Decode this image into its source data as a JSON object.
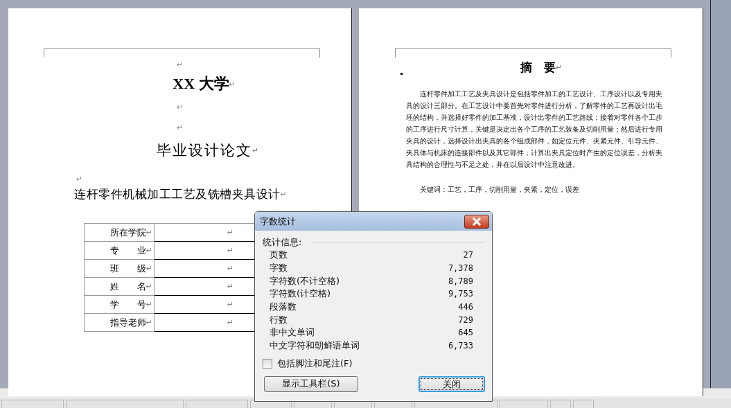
{
  "left_page": {
    "blocks": [
      {
        "kind": "mark_center",
        "text": "↵"
      },
      {
        "kind": "title",
        "text": "XX 大学",
        "mark": "↵"
      },
      {
        "kind": "mark_center",
        "text": "↵"
      },
      {
        "kind": "mark_center",
        "text": "↵"
      },
      {
        "kind": "subtitle",
        "text": "毕业设计论文",
        "mark": "↵"
      },
      {
        "kind": "mark_left",
        "text": "↵"
      },
      {
        "kind": "heading",
        "text": "连杆零件机械加工工艺及铣槽夹具设计",
        "mark": "↵"
      }
    ],
    "form_rows": [
      {
        "label": "所在学院",
        "label_mark": "↵",
        "value_mark": "↵"
      },
      {
        "label": "专　　业",
        "label_mark": "↵",
        "value_mark": "↵"
      },
      {
        "label": "班　　级",
        "label_mark": "↵",
        "value_mark": "↵"
      },
      {
        "label": "姓　　名",
        "label_mark": "↵",
        "value_mark": "↵"
      },
      {
        "label": "学　　号",
        "label_mark": "↵",
        "value_mark": "↵"
      },
      {
        "label": "指导老师",
        "label_mark": "↵",
        "value_mark": "↵"
      }
    ]
  },
  "right_page": {
    "title": "摘　要",
    "title_mark": "↵",
    "abstract": "连杆零件加工工艺及夹具设计是包括零件加工的工艺设计、工序设计以及专用夹具的设计三部分。在工艺设计中要首先对零件进行分析，了解零件的工艺再设计出毛坯的结构，并选择好零件的加工基准，设计出零件的工艺路线；接着对零件各个工步的工序进行尺寸计算，关键是决定出各个工序的工艺装备及切削用量；然后进行专用夹具的设计，选择设计出夹具的各个组成部件，如定位元件、夹紧元件、引导元件、夹具体与机床的连接部件以及其它部件；计算出夹具定位时产生的定位误差，分析夹具结构的合理性与不足之处，并在以后设计中注意改进。",
    "keywords": "关键词：工艺，工序，切削用量，夹紧，定位，误差"
  },
  "dialog": {
    "title": "字数统计",
    "section": "统计信息:",
    "stats": [
      {
        "label": "页数",
        "value": "27"
      },
      {
        "label": "字数",
        "value": "7,378"
      },
      {
        "label": "字符数(不计空格)",
        "value": "8,789"
      },
      {
        "label": "字符数(计空格)",
        "value": "9,753"
      },
      {
        "label": "段落数",
        "value": "446"
      },
      {
        "label": "行数",
        "value": "729"
      },
      {
        "label": "非中文单词",
        "value": "645"
      },
      {
        "label": "中文字符和朝鲜语单词",
        "value": "6,733"
      }
    ],
    "checkbox": {
      "label": "包括脚注和尾注(F)",
      "checked": false
    },
    "buttons": [
      {
        "label": "显示工具栏(S)",
        "focused": false
      },
      {
        "label": "关闭",
        "focused": true
      }
    ]
  }
}
